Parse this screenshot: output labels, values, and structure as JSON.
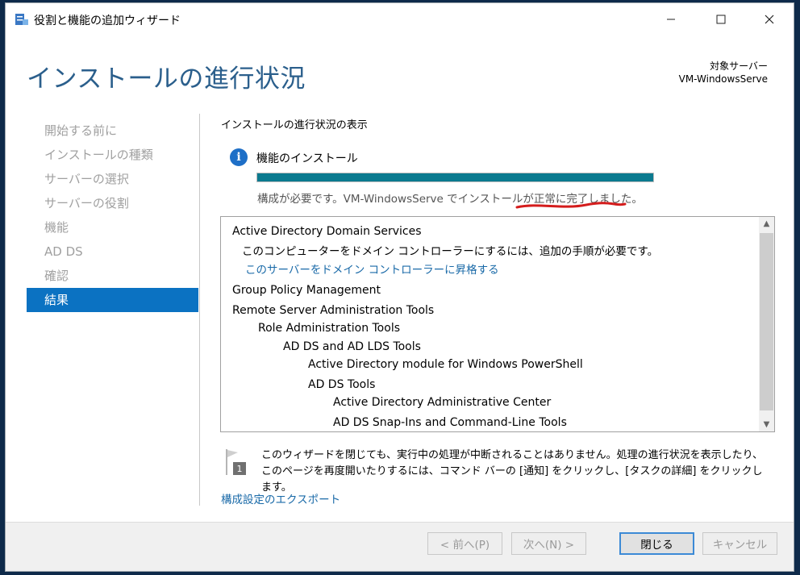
{
  "window": {
    "title": "役割と機能の追加ウィザード",
    "page_title": "インストールの進行状況",
    "target_label": "対象サーバー",
    "target_server": "VM-WindowsServe"
  },
  "nav": {
    "items": [
      {
        "label": "開始する前に",
        "active": false
      },
      {
        "label": "インストールの種類",
        "active": false
      },
      {
        "label": "サーバーの選択",
        "active": false
      },
      {
        "label": "サーバーの役割",
        "active": false
      },
      {
        "label": "機能",
        "active": false
      },
      {
        "label": "AD DS",
        "active": false
      },
      {
        "label": "確認",
        "active": false
      },
      {
        "label": "結果",
        "active": true
      }
    ]
  },
  "main": {
    "section_title": "インストールの進行状況の表示",
    "feature_label": "機能のインストール",
    "progress": 1.0,
    "status": "構成が必要です。VM-WindowsServe でインストールが正常に完了しました。",
    "results": {
      "adds_title": "Active Directory Domain Services",
      "adds_detail": "このコンピューターをドメイン コントローラーにするには、追加の手順が必要です。",
      "adds_link": "このサーバーをドメイン コントローラーに昇格する",
      "gpm": "Group Policy Management",
      "rsat": "Remote Server Administration Tools",
      "role_tools": "Role Administration Tools",
      "adds_lds_tools": "AD DS and AD LDS Tools",
      "ps_module": "Active Directory module for Windows PowerShell",
      "adds_tools": "AD DS Tools",
      "admin_center": "Active Directory Administrative Center",
      "snapins": "AD DS Snap-Ins and Command-Line Tools"
    },
    "note": "このウィザードを閉じても、実行中の処理が中断されることはありません。処理の進行状況を表示したり、このページを再度開いたりするには、コマンド バーの [通知] をクリックし、[タスクの詳細] をクリックします。",
    "note_badge": "1",
    "export_link": "構成設定のエクスポート"
  },
  "footer": {
    "prev": "< 前へ(P)",
    "next": "次へ(N) >",
    "close": "閉じる",
    "cancel": "キャンセル"
  },
  "colors": {
    "accent": "#0b72c2",
    "header": "#2b5f8c",
    "progress": "#0b7a8f",
    "link": "#1a6aa8",
    "annotation": "#d41c1c"
  }
}
